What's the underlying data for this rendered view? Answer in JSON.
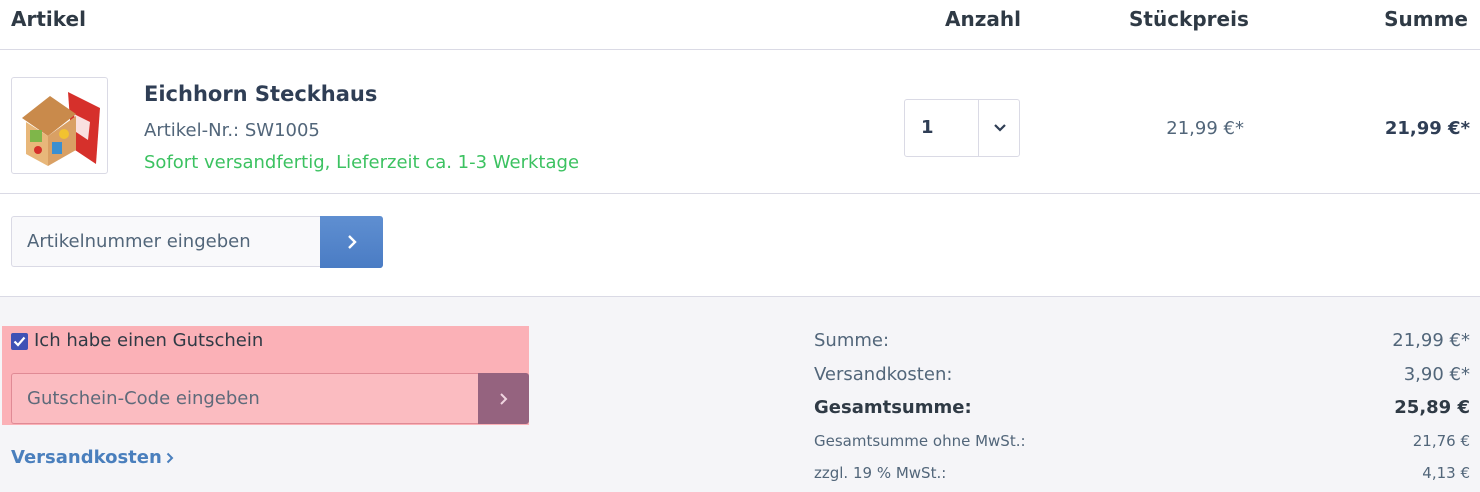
{
  "table_header": {
    "article": "Artikel",
    "quantity": "Anzahl",
    "unit_price": "Stückpreis",
    "sum": "Summe"
  },
  "cart_item": {
    "name": "Eichhorn Steckhaus",
    "article_number": "Artikel-Nr.: SW1005",
    "delivery": "Sofort versandfertig, Lieferzeit ca. 1-3 Werktage",
    "quantity": "1",
    "unit_price": "21,99 €*",
    "row_total": "21,99 €*"
  },
  "add_article": {
    "placeholder": "Artikelnummer eingeben"
  },
  "voucher": {
    "checkbox_label": "Ich habe einen Gutschein",
    "checked": true,
    "placeholder": "Gutschein-Code eingeben"
  },
  "shipping_link": "Versandkosten",
  "totals": [
    {
      "label": "Summe:",
      "value": "21,99 €*",
      "style": "big"
    },
    {
      "label": "Versandkosten:",
      "value": "3,90 €*",
      "style": "big"
    },
    {
      "label": "Gesamtsumme:",
      "value": "25,89 €",
      "style": "bold"
    },
    {
      "label": "Gesamtsumme ohne MwSt.:",
      "value": "21,76 €",
      "style": "small"
    },
    {
      "label": "zzgl. 19 % MwSt.:",
      "value": "4,13 €",
      "style": "small"
    }
  ],
  "colors": {
    "availability_green": "#3cc261",
    "primary_blue": "#4a7cc4",
    "link_blue": "#4a7fbd",
    "highlight": "#ff7882"
  }
}
